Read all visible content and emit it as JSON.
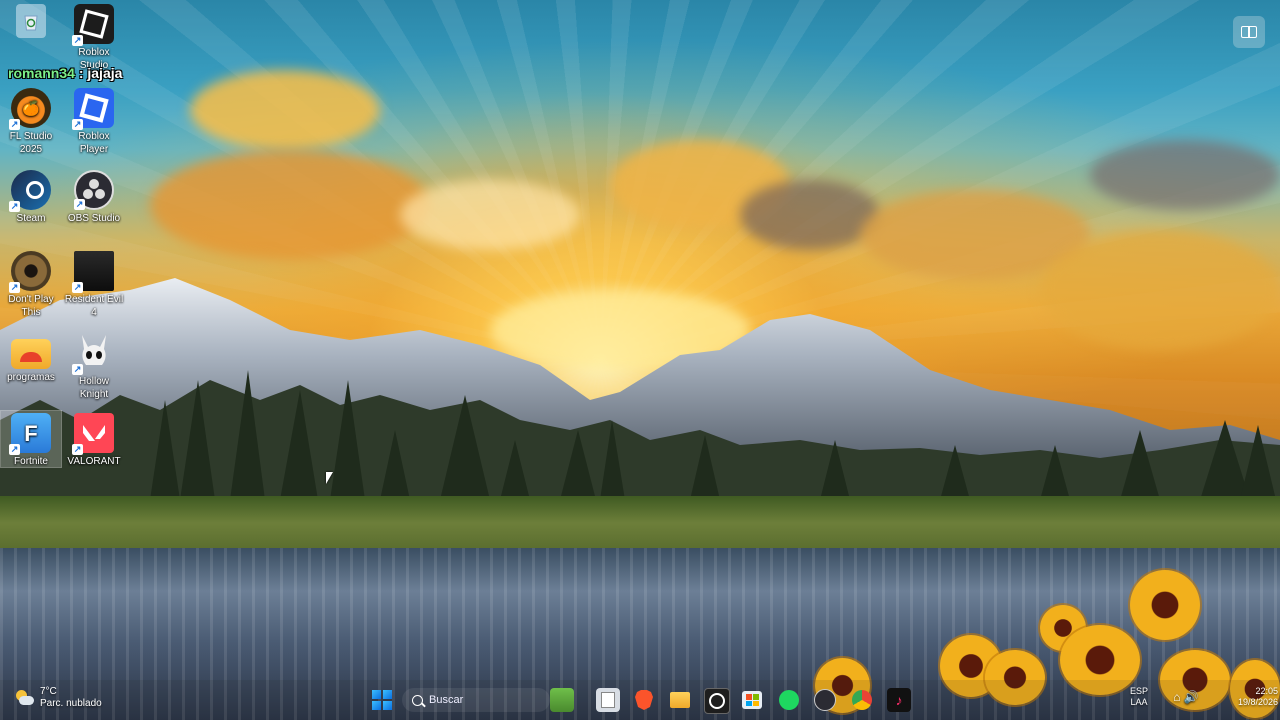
{
  "desktop": {
    "chat_overlay": {
      "user": "romann34",
      "separator": ":",
      "message": "jajaja"
    },
    "icons": [
      {
        "label": "",
        "name": "recycle-bin"
      },
      {
        "label": "Roblox Studio"
      },
      {
        "label": "FL Studio 2025"
      },
      {
        "label": "Roblox Player"
      },
      {
        "label": "Steam"
      },
      {
        "label": "OBS Studio"
      },
      {
        "label": "Don't Play This"
      },
      {
        "label": "Resident Evil 4"
      },
      {
        "label": "programas"
      },
      {
        "label": "Hollow Knight"
      },
      {
        "label": "Fortnite"
      },
      {
        "label": "VALORANT"
      }
    ]
  },
  "taskbar": {
    "weather": {
      "temperature": "7°C",
      "condition": "Parc. nublado",
      "icon": "partly-cloudy-icon"
    },
    "search_placeholder": "Buscar",
    "apps": [
      "start-icon",
      "search-icon",
      "minecraft-icon",
      "file-explorer-icon",
      "brave-icon",
      "folder-icon",
      "chatgpt-icon",
      "microsoft-store-icon",
      "spotify-icon",
      "obs-icon",
      "chrome-icon",
      "tiktok-icon"
    ],
    "tray": {
      "language": "ESP",
      "layout": "LAA",
      "time": "22:05",
      "date": "19/8/2026"
    }
  },
  "colors": {
    "accent": "#0a6fe0",
    "chat_user": "#7cf08a"
  }
}
